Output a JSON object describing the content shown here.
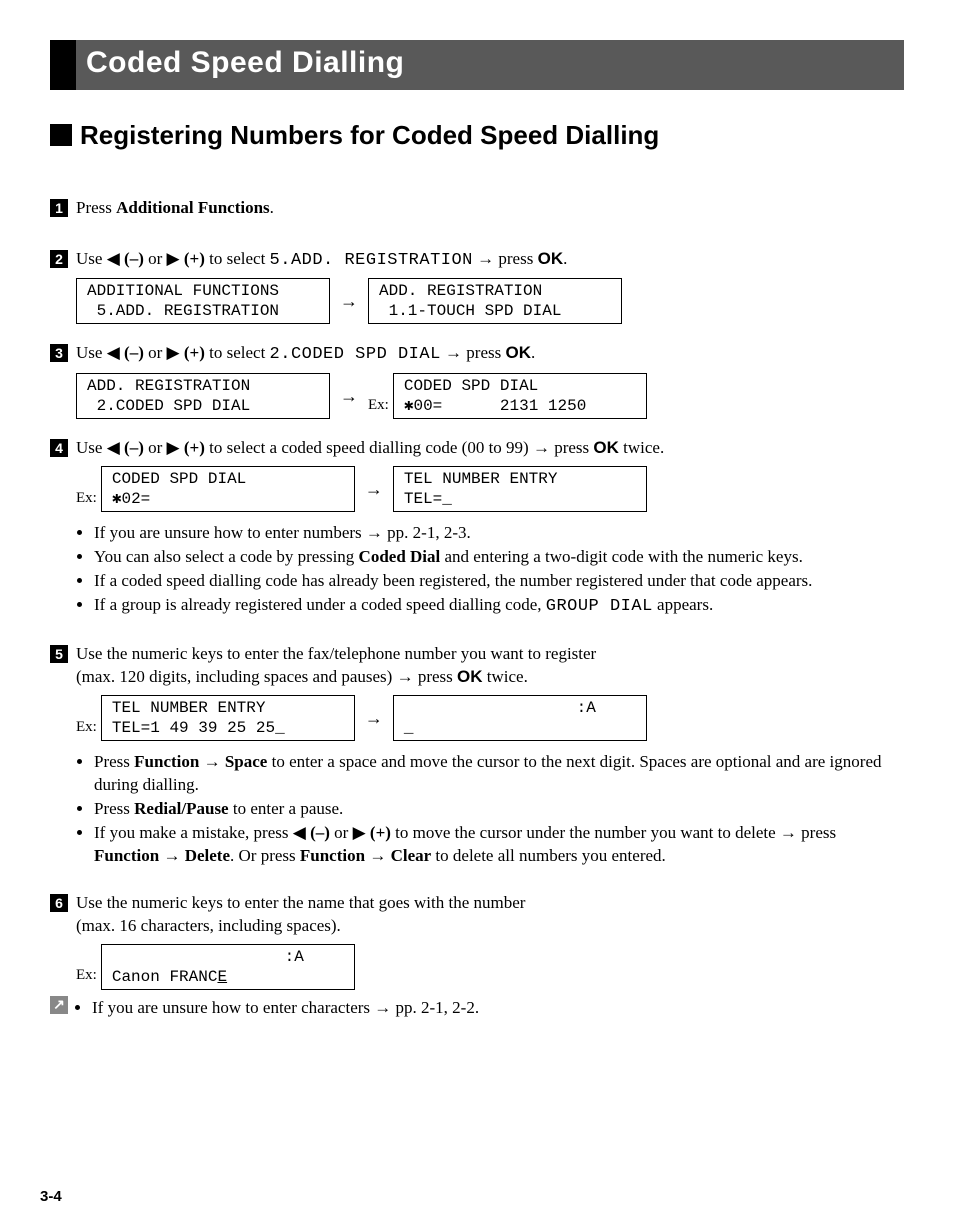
{
  "title": "Coded Speed Dialling",
  "subheader": "Registering Numbers for Coded Speed Dialling",
  "labels": {
    "ex": "Ex:",
    "arrow_right": "→",
    "tri_left": "◀",
    "tri_right": "▶",
    "minus": "(–)",
    "plus": "(+)",
    "ok": "OK"
  },
  "steps": {
    "s1": {
      "num": "1",
      "text_a": "Press ",
      "text_b": "Additional Functions",
      "text_c": "."
    },
    "s2": {
      "num": "2",
      "prefix": "Use ",
      "mid": " or ",
      "select": " to select ",
      "target": "5.ADD. REGISTRATION",
      "press": " → press ",
      "tail": ".",
      "lcd1": "ADDITIONAL FUNCTIONS\n 5.ADD. REGISTRATION",
      "lcd2": "ADD. REGISTRATION\n 1.1-TOUCH SPD DIAL"
    },
    "s3": {
      "num": "3",
      "prefix": "Use ",
      "mid": " or ",
      "select": " to select ",
      "target": "2.CODED SPD DIAL",
      "press": " → press ",
      "tail": ".",
      "lcd1": "ADD. REGISTRATION\n 2.CODED SPD DIAL",
      "lcd2": "CODED SPD DIAL\n✱00=      2131 1250"
    },
    "s4": {
      "num": "4",
      "prefix": "Use ",
      "mid": " or ",
      "select": " to select a coded speed dialling code (00 to 99) → press ",
      "tail": " twice.",
      "lcd1": "CODED SPD DIAL\n✱02=",
      "lcd2": "TEL NUMBER ENTRY\nTEL=_",
      "bullets": [
        {
          "a": "If you are unsure how to enter numbers → pp. 2-1, 2-3."
        },
        {
          "a": "You can also select a code by pressing ",
          "b": "Coded Dial",
          "c": " and entering a two-digit code with the numeric keys."
        },
        {
          "a": "If a coded speed dialling code has already been registered, the number registered under that code appears."
        },
        {
          "a": "If a group is already registered under a coded speed dialling code, ",
          "mono": "GROUP DIAL",
          "c": " appears."
        }
      ]
    },
    "s5": {
      "num": "5",
      "line1": "Use the numeric keys to enter the fax/telephone number you want to register",
      "line2a": "(max. 120 digits, including spaces and pauses) → press ",
      "line2b": " twice.",
      "lcd1": "TEL NUMBER ENTRY\nTEL=1 49 39 25 25_",
      "lcd2": "                  :A\n_",
      "bullets": [
        {
          "a": "Press ",
          "b": "Function",
          "c": " → ",
          "d": "Space",
          "e": " to enter a space and move the cursor to the next digit. Spaces are optional and are ignored during dialling."
        },
        {
          "a": "Press ",
          "b": "Redial/Pause",
          "c": " to enter a pause."
        },
        {
          "a": "If you make a mistake, press ",
          "tri1": true,
          "c": " or ",
          "tri2": true,
          "e": " to move the cursor under the number you want to delete → press ",
          "f": "Function",
          "g": " → ",
          "h": "Delete",
          "i": ". Or press ",
          "j": "Function",
          "k": " → ",
          "l": "Clear",
          "m": " to delete all numbers you entered."
        }
      ]
    },
    "s6": {
      "num": "6",
      "line1": "Use the numeric keys to enter the name that goes with the number",
      "line2": "(max. 16 characters, including spaces).",
      "lcd1_a": "                  :A",
      "lcd1_b": "Canon FRANC",
      "lcd1_c": "E"
    },
    "continue_bullet": "If you are unsure how to enter characters → pp. 2-1, 2-2."
  },
  "page_number": "3-4"
}
